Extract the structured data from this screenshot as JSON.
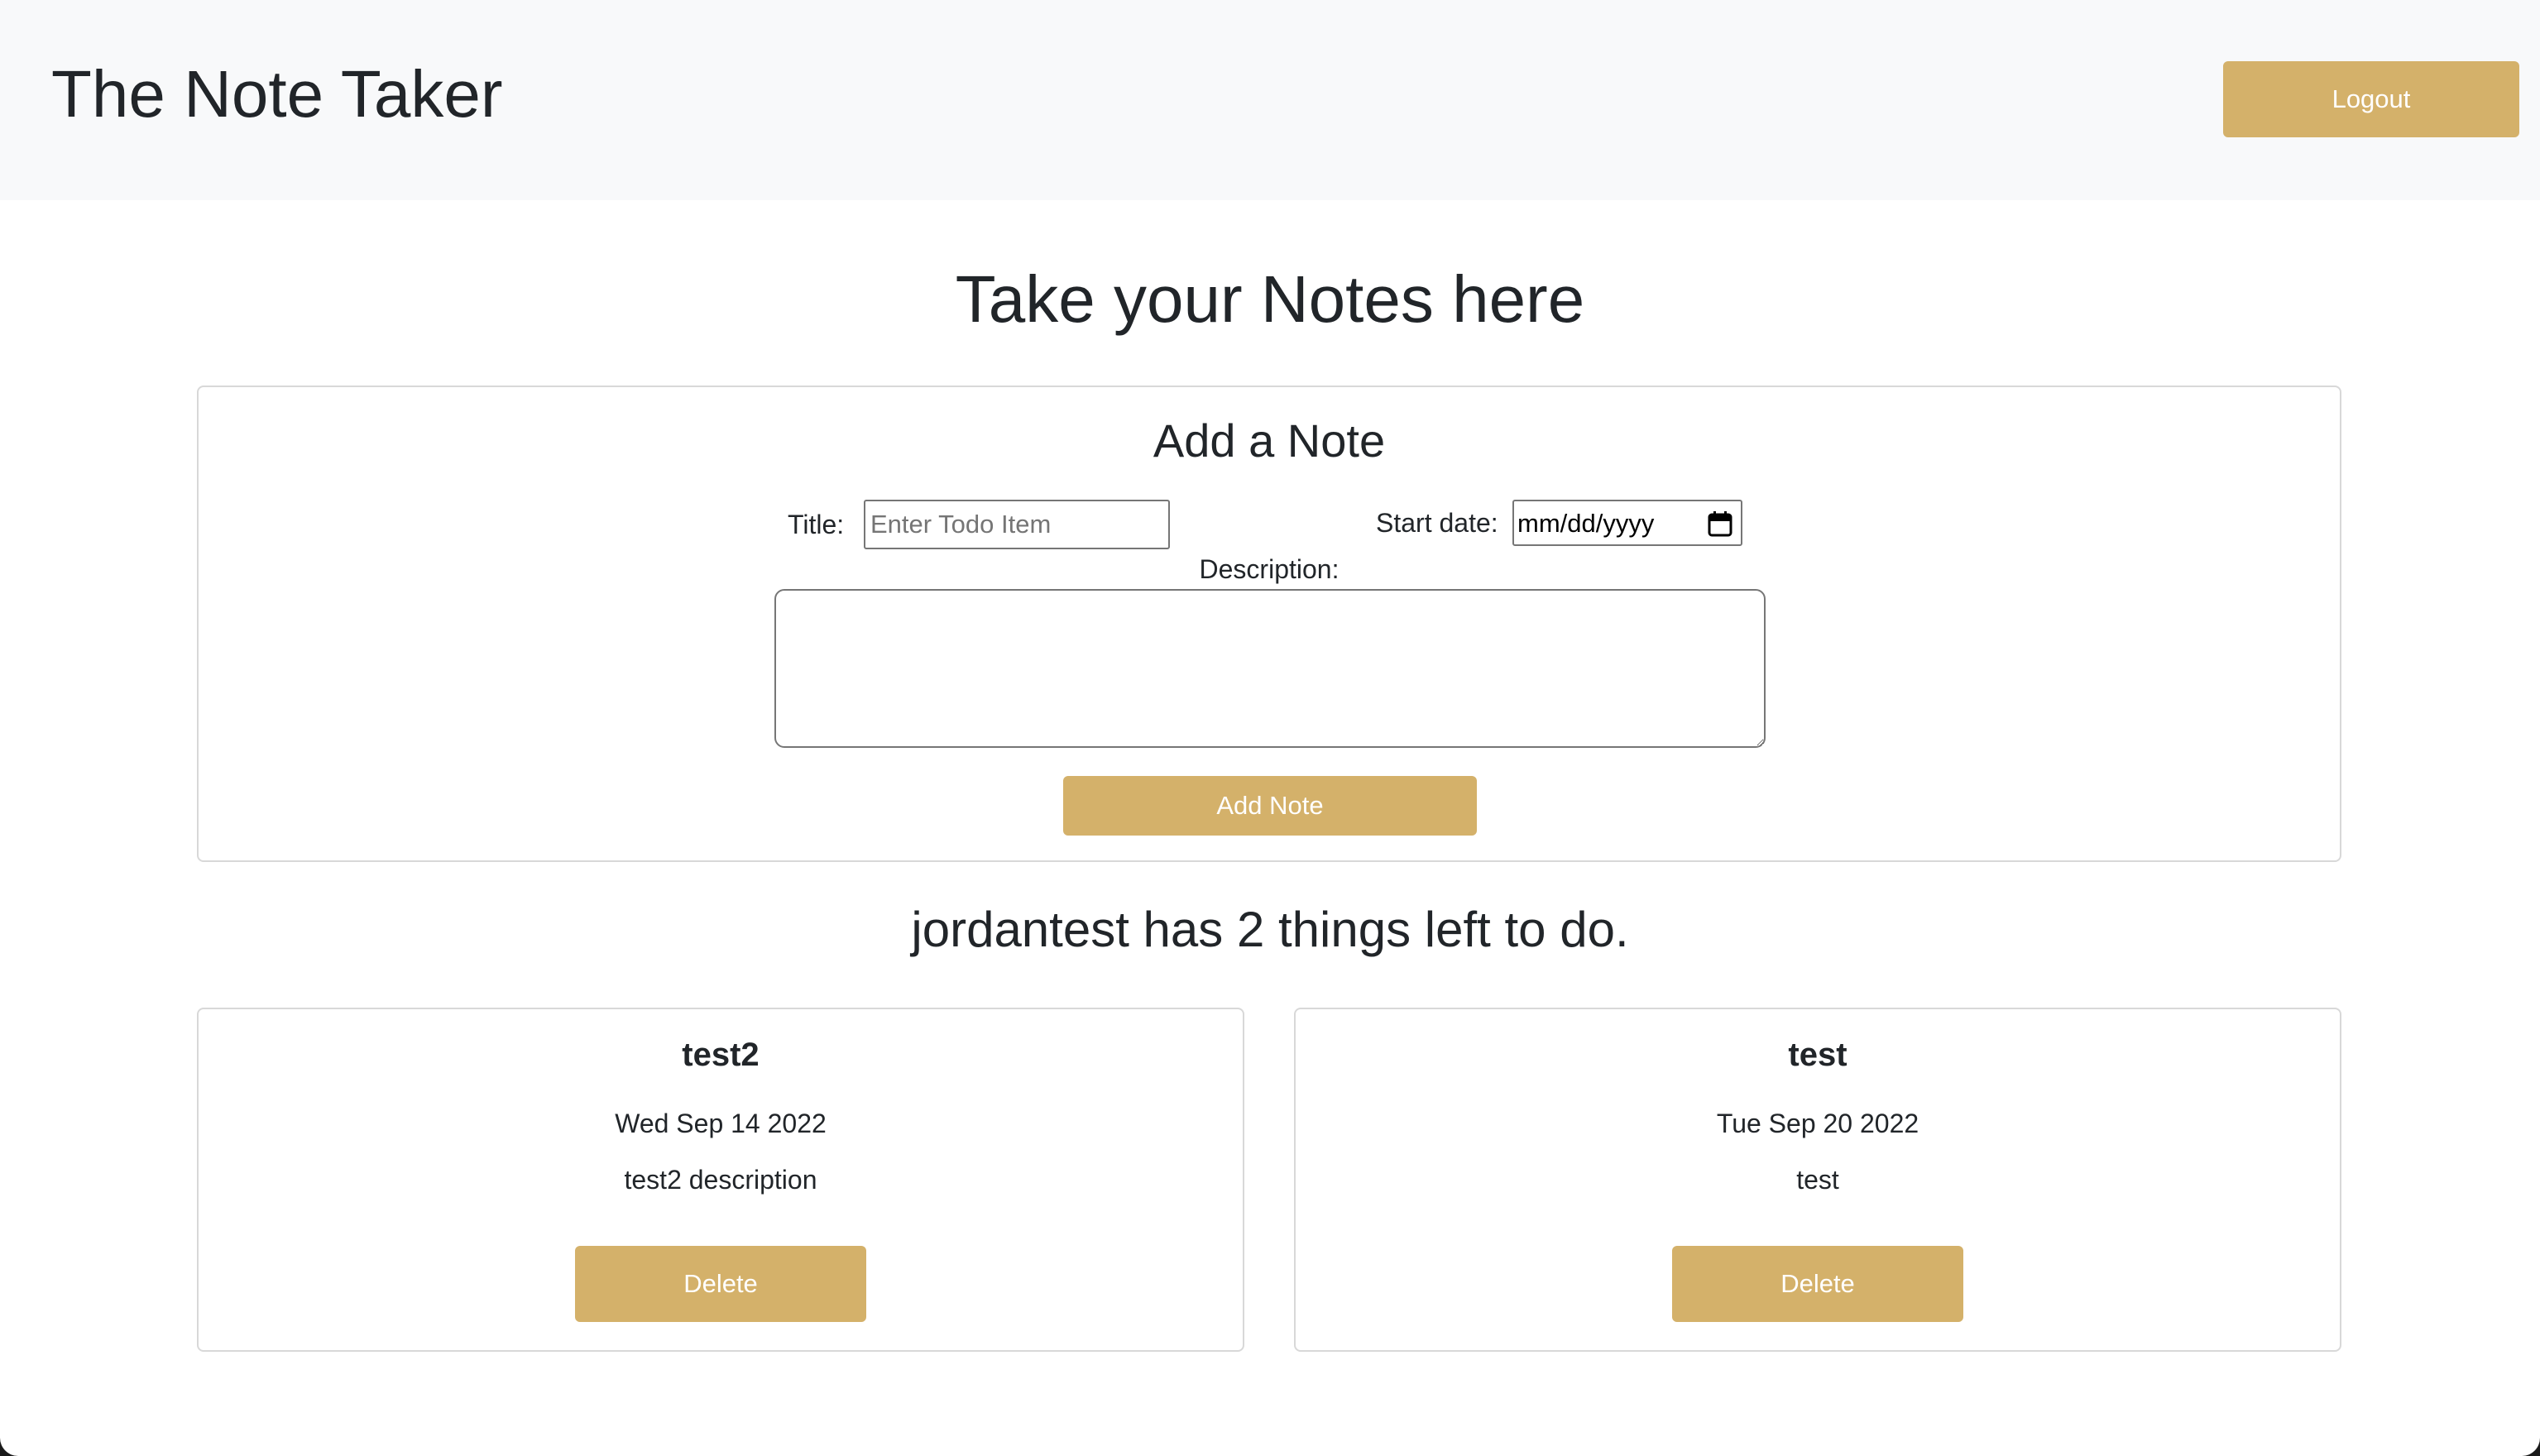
{
  "header": {
    "brand": "The Note Taker",
    "logout_label": "Logout"
  },
  "main": {
    "heading": "Take your Notes here",
    "form": {
      "title": "Add a Note",
      "title_label": "Title:",
      "title_placeholder": "Enter Todo Item",
      "title_value": "",
      "date_label": "Start date:",
      "date_placeholder": "mm/dd/yyyy",
      "description_label": "Description:",
      "description_value": "",
      "submit_label": "Add Note"
    },
    "summary": "jordantest has 2 things left to do.",
    "notes": [
      {
        "title": "test2",
        "date": "Wed Sep 14 2022",
        "description": "test2 description",
        "delete_label": "Delete"
      },
      {
        "title": "test",
        "date": "Tue Sep 20 2022",
        "description": "test",
        "delete_label": "Delete"
      }
    ]
  },
  "colors": {
    "accent": "#d4b16a",
    "navbar_bg": "#f8f9fa",
    "text": "#212529"
  },
  "icons": {
    "date_picker": "calendar-icon"
  }
}
